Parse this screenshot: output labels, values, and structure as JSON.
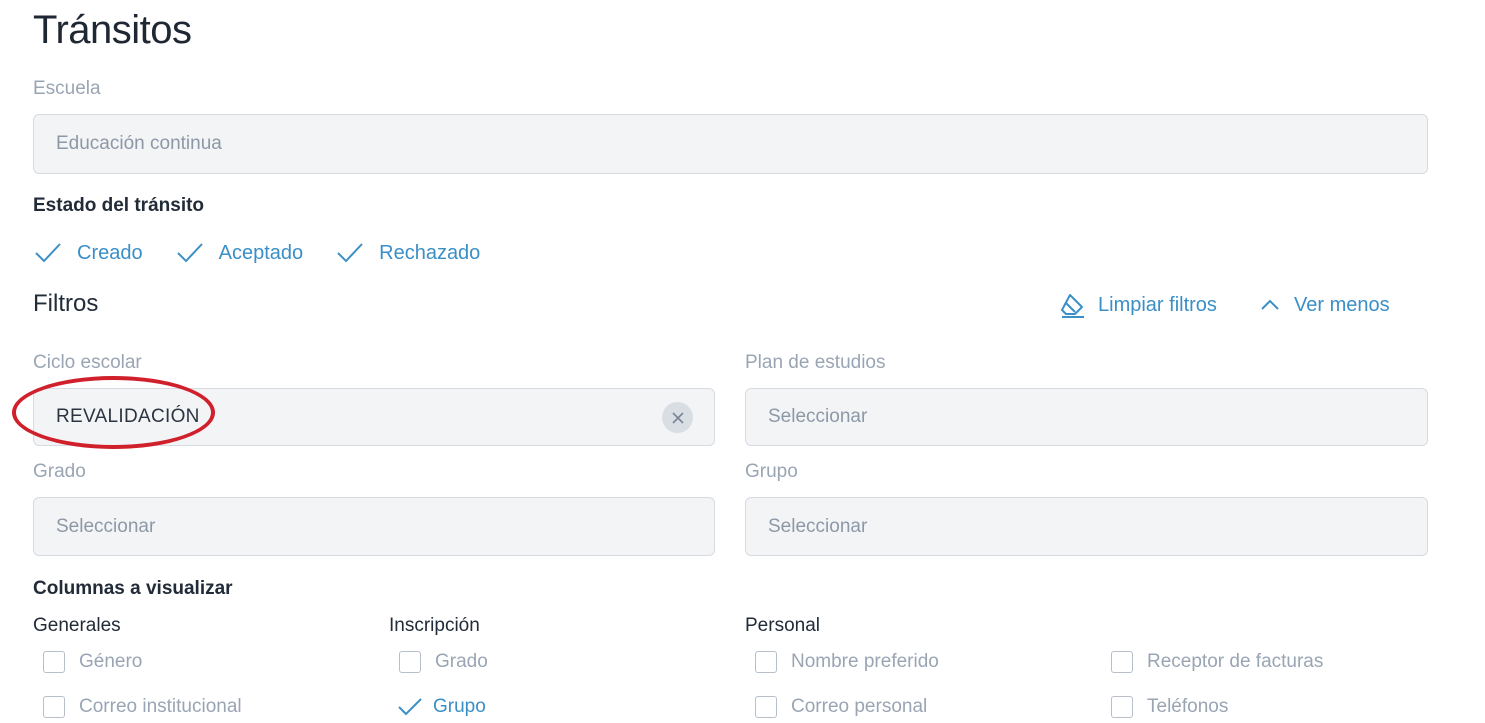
{
  "page": {
    "title": "Tránsitos"
  },
  "escuela": {
    "label": "Escuela",
    "value": "Educación continua"
  },
  "estado": {
    "label": "Estado del tránsito",
    "options": [
      {
        "label": "Creado",
        "checked": true
      },
      {
        "label": "Aceptado",
        "checked": true
      },
      {
        "label": "Rechazado",
        "checked": true
      }
    ]
  },
  "filtros": {
    "heading": "Filtros",
    "clear_label": "Limpiar filtros",
    "toggle_label": "Ver menos",
    "ciclo": {
      "label": "Ciclo escolar",
      "value": "REVALIDACIÓN"
    },
    "plan": {
      "label": "Plan de estudios",
      "placeholder": "Seleccionar"
    },
    "grado": {
      "label": "Grado",
      "placeholder": "Seleccionar"
    },
    "grupo": {
      "label": "Grupo",
      "placeholder": "Seleccionar"
    }
  },
  "columnas": {
    "label": "Columnas a visualizar",
    "groups": [
      {
        "name": "Generales",
        "items": [
          {
            "label": "Género",
            "checked": false
          },
          {
            "label": "Correo institucional",
            "checked": false
          }
        ]
      },
      {
        "name": "Inscripción",
        "items": [
          {
            "label": "Grado",
            "checked": false
          },
          {
            "label": "Grupo",
            "checked": true
          }
        ]
      },
      {
        "name": "Personal",
        "items": [
          {
            "label": "Nombre preferido",
            "checked": false
          },
          {
            "label": "Correo personal",
            "checked": false
          }
        ]
      },
      {
        "name": "",
        "items": [
          {
            "label": "Receptor de facturas",
            "checked": false
          },
          {
            "label": "Teléfonos",
            "checked": false
          }
        ]
      }
    ]
  },
  "colors": {
    "accent": "#3a8fc7",
    "annotation": "#d0202c",
    "input_bg": "#f3f4f6"
  }
}
